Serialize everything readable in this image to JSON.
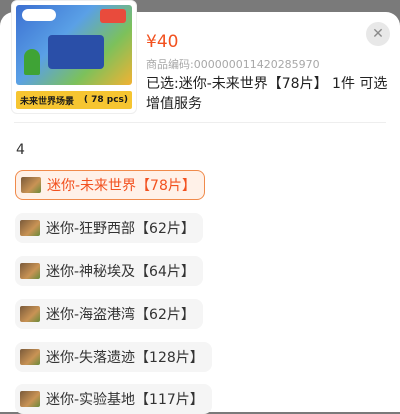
{
  "product": {
    "image_caption": "未来世界场景",
    "image_pcs": "( 78 pcs)",
    "price": "¥40",
    "code": "商品编码:000000011420285970",
    "selected_text": "已选:迷你-未来世界【78片】  1件 可选增值服务"
  },
  "spec_group_label": "4",
  "options": [
    {
      "label": "迷你-未来世界【78片】",
      "selected": true
    },
    {
      "label": "迷你-狂野西部【62片】",
      "selected": false
    },
    {
      "label": "迷你-神秘埃及【64片】",
      "selected": false
    },
    {
      "label": "迷你-海盗港湾【62片】",
      "selected": false
    },
    {
      "label": "迷你-失落遗迹【128片】",
      "selected": false
    },
    {
      "label": "迷你-实验基地【117片】",
      "selected": false
    }
  ],
  "icons": {
    "close": "close-icon"
  },
  "colors": {
    "accent": "#f2511f",
    "selected_border": "#f08a4b",
    "selected_bg": "#fff1e8",
    "option_bg": "#f5f5f5"
  }
}
